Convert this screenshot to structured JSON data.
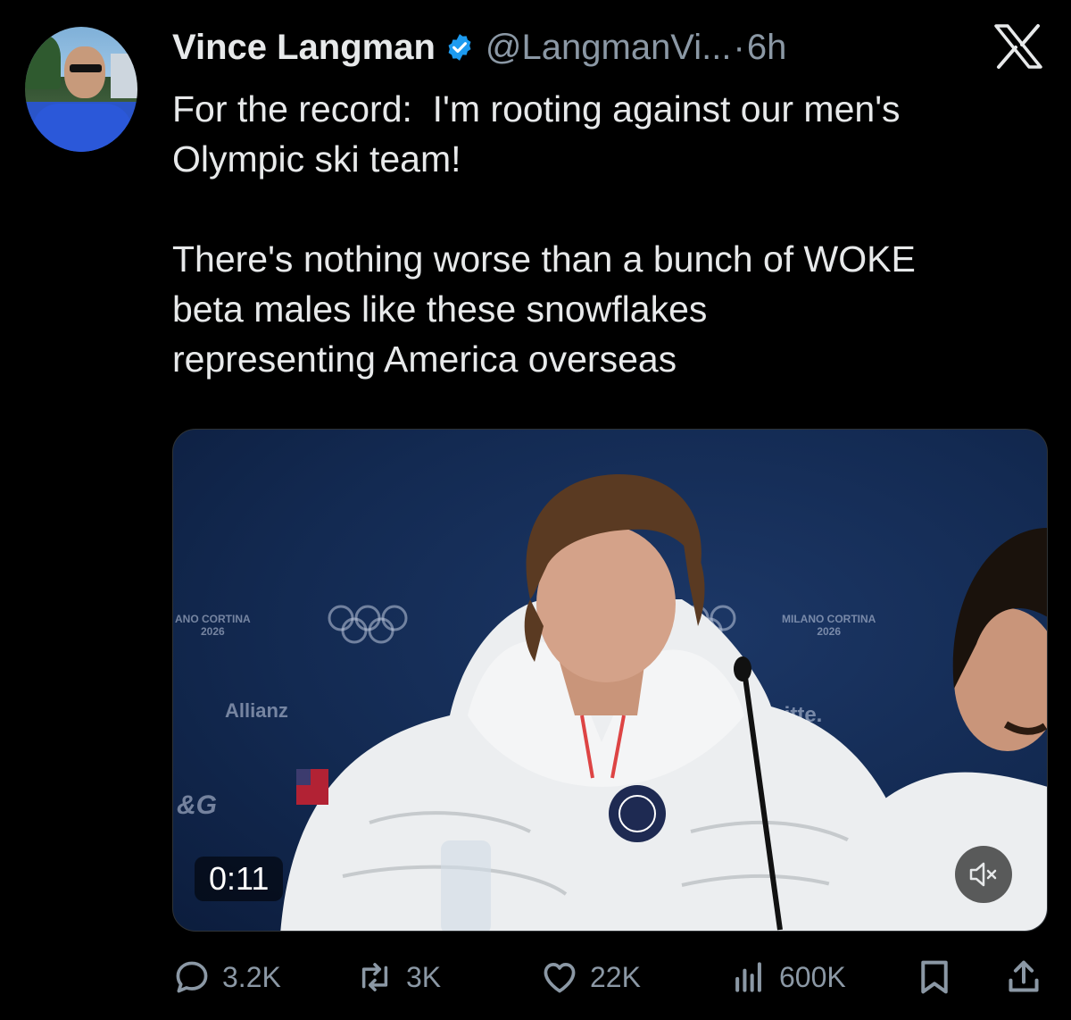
{
  "author": {
    "name": "Vince Langman",
    "handle": "@LangmanVi...",
    "separator": "·",
    "time": "6h",
    "verified": true,
    "verified_color": "#1d9bf0"
  },
  "tweet": {
    "text": "For the record:  I'm rooting against our men's\nOlympic ski team!\n\nThere's nothing worse than a bunch of WOKE\nbeta males like these snowflakes\nrepresenting America overseas"
  },
  "media": {
    "duration": "0:11",
    "backdrop_text": {
      "left_event": "ANO CORTINA\n2026",
      "right_event": "MILANO CORTINA\n2026",
      "sponsor_left": "Allianz",
      "sponsor_right": "eloitte.",
      "sponsor_pg": "&G"
    }
  },
  "actions": {
    "replies": "3.2K",
    "reposts": "3K",
    "likes": "22K",
    "views": "600K"
  },
  "icons": {
    "logo": "x-logo-icon",
    "verified": "verified-badge-icon",
    "reply": "reply-icon",
    "repost": "repost-icon",
    "like": "heart-icon",
    "views": "views-chart-icon",
    "bookmark": "bookmark-icon",
    "share": "share-icon",
    "mute": "muted-speaker-icon"
  },
  "colors": {
    "background": "#000000",
    "text": "#e7e9ea",
    "muted": "#8b98a5",
    "accent": "#1d9bf0"
  }
}
